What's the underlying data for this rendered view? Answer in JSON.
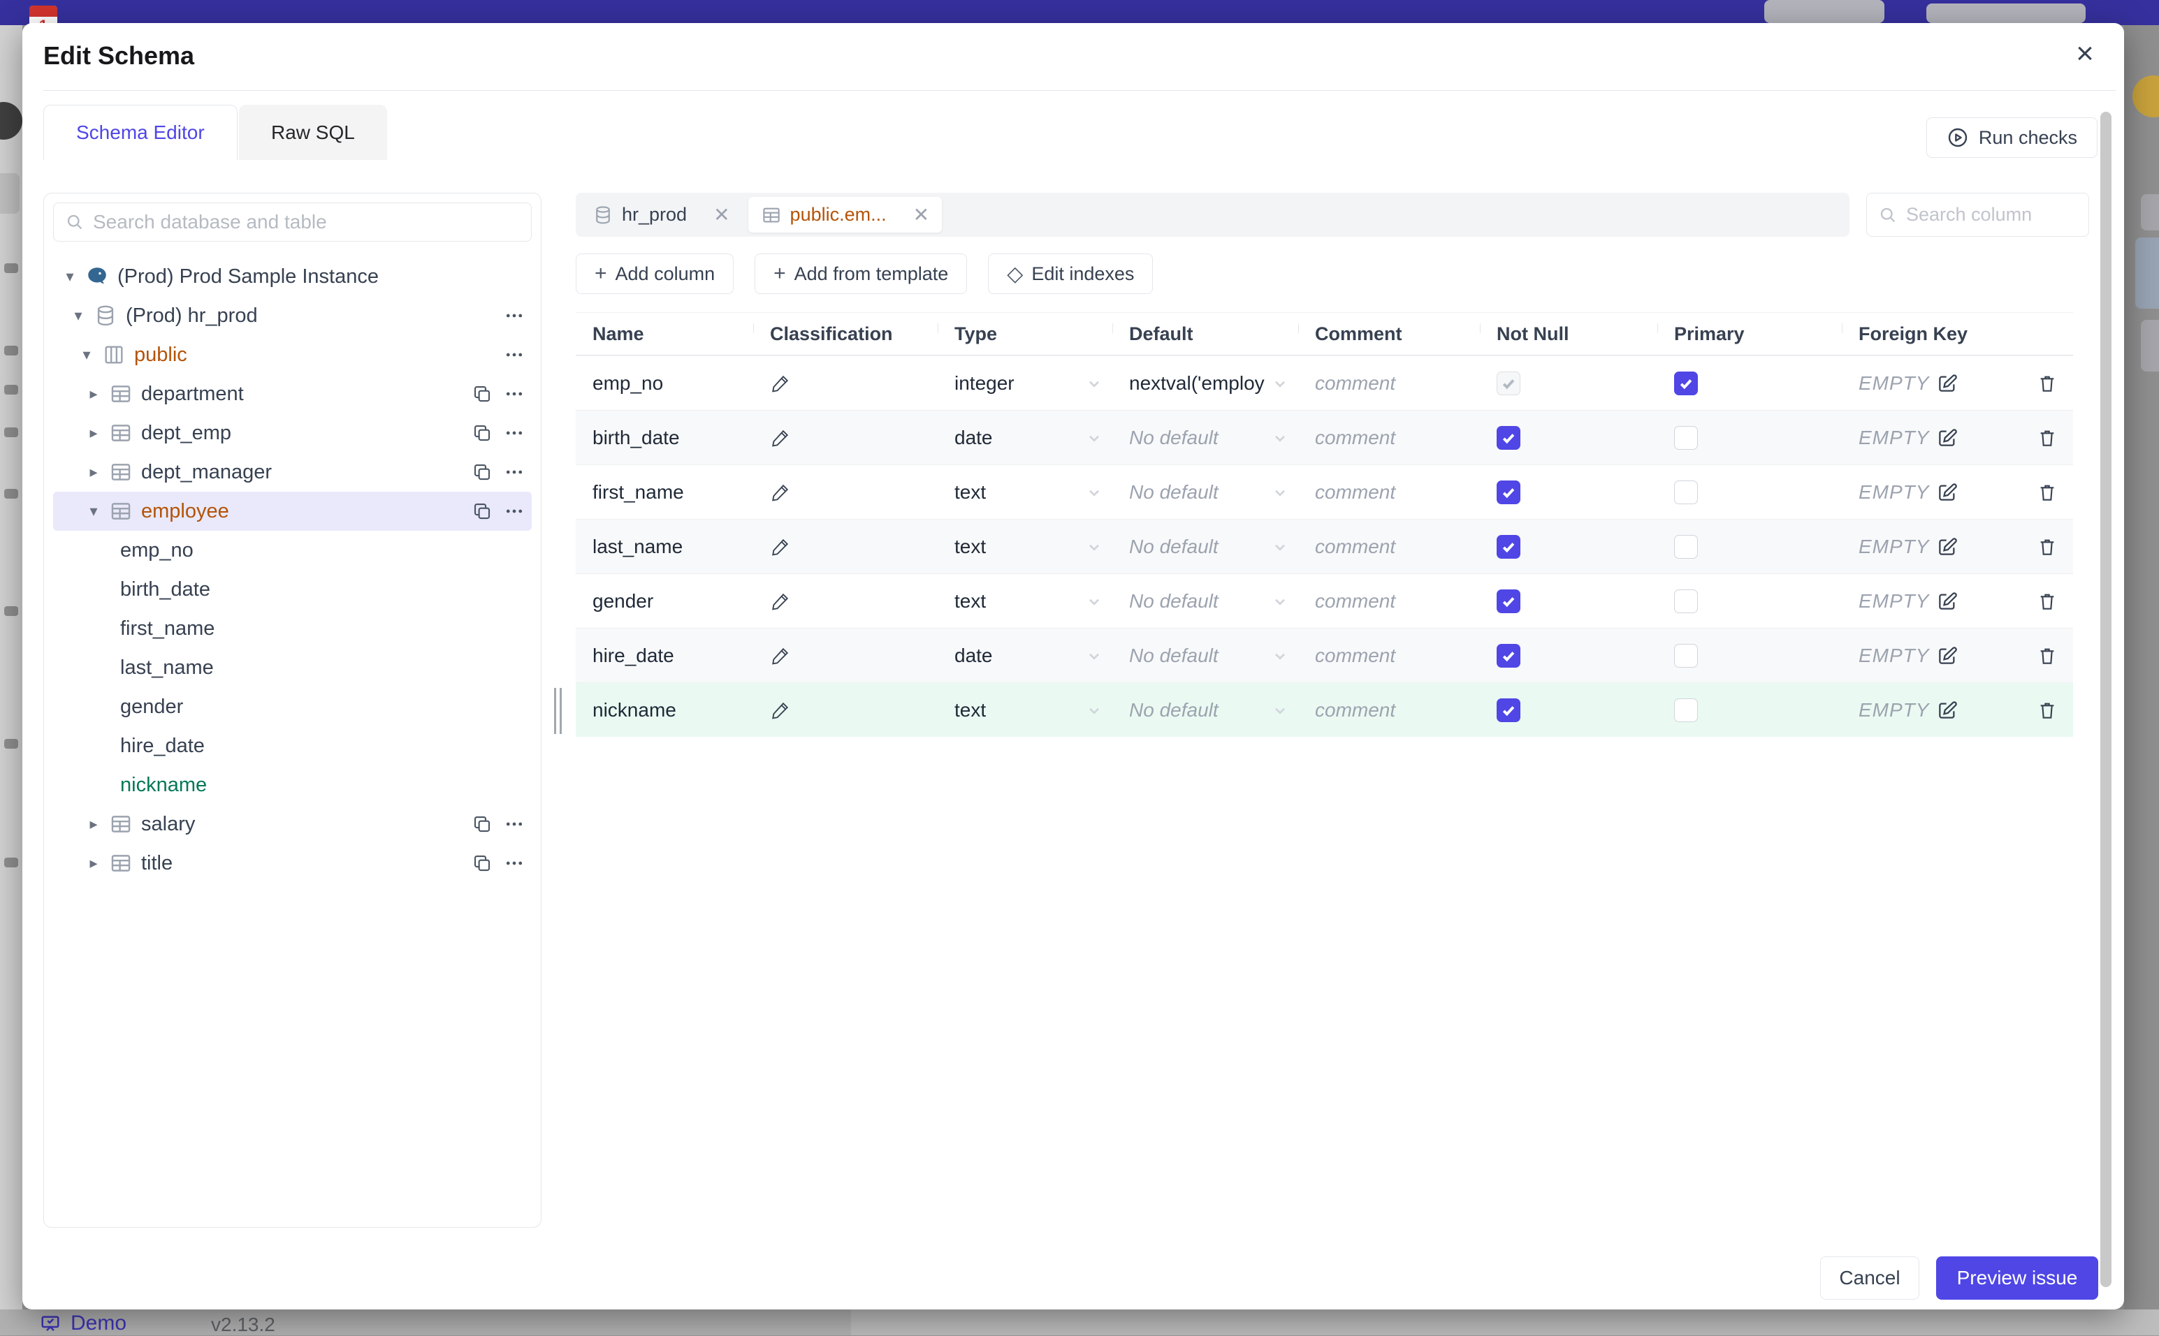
{
  "colors": {
    "accent_indigo": "#4f46e5",
    "schema_orange": "#b45309",
    "new_column_green": "#047857",
    "new_row_bg": "#eafaf2",
    "selected_tree_bg": "#e9e9fb",
    "topbar_indigo": "#36309e"
  },
  "background": {
    "demo_label": "Demo",
    "version": "v2.13.2"
  },
  "modal": {
    "title": "Edit Schema",
    "close_glyph": "×",
    "tabs": [
      {
        "label": "Schema Editor",
        "active": true
      },
      {
        "label": "Raw SQL",
        "active": false
      }
    ],
    "run_checks_label": "Run checks",
    "sidebar": {
      "search_placeholder": "Search database and table",
      "tree": [
        {
          "label": "(Prod) Prod Sample Instance",
          "icon": "postgres",
          "caret": "open",
          "level": 0
        },
        {
          "label": "(Prod) hr_prod",
          "icon": "database",
          "caret": "open",
          "level": 1,
          "actions": [
            "more"
          ]
        },
        {
          "label": "public",
          "icon": "schema",
          "caret": "open",
          "level": 2,
          "color": "orange",
          "actions": [
            "more"
          ]
        },
        {
          "label": "department",
          "icon": "table",
          "caret": "closed",
          "level": 3,
          "actions": [
            "copy",
            "more"
          ]
        },
        {
          "label": "dept_emp",
          "icon": "table",
          "caret": "closed",
          "level": 3,
          "actions": [
            "copy",
            "more"
          ]
        },
        {
          "label": "dept_manager",
          "icon": "table",
          "caret": "closed",
          "level": 3,
          "actions": [
            "copy",
            "more"
          ]
        },
        {
          "label": "employee",
          "icon": "table",
          "caret": "open",
          "level": 3,
          "color": "orange",
          "selected": true,
          "actions": [
            "copy",
            "more"
          ]
        },
        {
          "label": "emp_no",
          "level": "column"
        },
        {
          "label": "birth_date",
          "level": "column"
        },
        {
          "label": "first_name",
          "level": "column"
        },
        {
          "label": "last_name",
          "level": "column"
        },
        {
          "label": "gender",
          "level": "column"
        },
        {
          "label": "hire_date",
          "level": "column"
        },
        {
          "label": "nickname",
          "level": "column",
          "color": "green"
        },
        {
          "label": "salary",
          "icon": "table",
          "caret": "closed",
          "level": 3,
          "actions": [
            "copy",
            "more"
          ]
        },
        {
          "label": "title",
          "icon": "table",
          "caret": "closed",
          "level": 3,
          "actions": [
            "copy",
            "more"
          ]
        }
      ]
    },
    "editor": {
      "open_tabs": [
        {
          "label": "hr_prod",
          "icon": "database",
          "selected": false,
          "close_glyph": "✕"
        },
        {
          "label": "public.em...",
          "icon": "table",
          "selected": true,
          "close_glyph": "✕"
        }
      ],
      "column_search_placeholder": "Search column",
      "toolbar": [
        {
          "label": "Add column",
          "glyph": "+"
        },
        {
          "label": "Add from template",
          "glyph": "+"
        },
        {
          "label": "Edit indexes",
          "glyph": "◇"
        }
      ],
      "table": {
        "headers": [
          "Name",
          "Classification",
          "Type",
          "Default",
          "Comment",
          "Not Null",
          "Primary",
          "Foreign Key"
        ],
        "placeholders": {
          "comment": "comment",
          "no_default": "No default",
          "foreign_key": "EMPTY"
        },
        "rows": [
          {
            "name": "emp_no",
            "type": "integer",
            "default": "nextval('employ",
            "has_default": true,
            "not_null": {
              "checked": true,
              "disabled": true
            },
            "primary": true,
            "highlight": "none"
          },
          {
            "name": "birth_date",
            "type": "date",
            "default": "",
            "has_default": false,
            "not_null": {
              "checked": true,
              "disabled": false
            },
            "primary": false,
            "highlight": "alt"
          },
          {
            "name": "first_name",
            "type": "text",
            "default": "",
            "has_default": false,
            "not_null": {
              "checked": true,
              "disabled": false
            },
            "primary": false,
            "highlight": "none"
          },
          {
            "name": "last_name",
            "type": "text",
            "default": "",
            "has_default": false,
            "not_null": {
              "checked": true,
              "disabled": false
            },
            "primary": false,
            "highlight": "alt"
          },
          {
            "name": "gender",
            "type": "text",
            "default": "",
            "has_default": false,
            "not_null": {
              "checked": true,
              "disabled": false
            },
            "primary": false,
            "highlight": "none"
          },
          {
            "name": "hire_date",
            "type": "date",
            "default": "",
            "has_default": false,
            "not_null": {
              "checked": true,
              "disabled": false
            },
            "primary": false,
            "highlight": "alt"
          },
          {
            "name": "nickname",
            "type": "text",
            "default": "",
            "has_default": false,
            "not_null": {
              "checked": true,
              "disabled": false
            },
            "primary": false,
            "highlight": "new"
          }
        ]
      }
    },
    "footer": {
      "cancel_label": "Cancel",
      "submit_label": "Preview issue"
    }
  }
}
